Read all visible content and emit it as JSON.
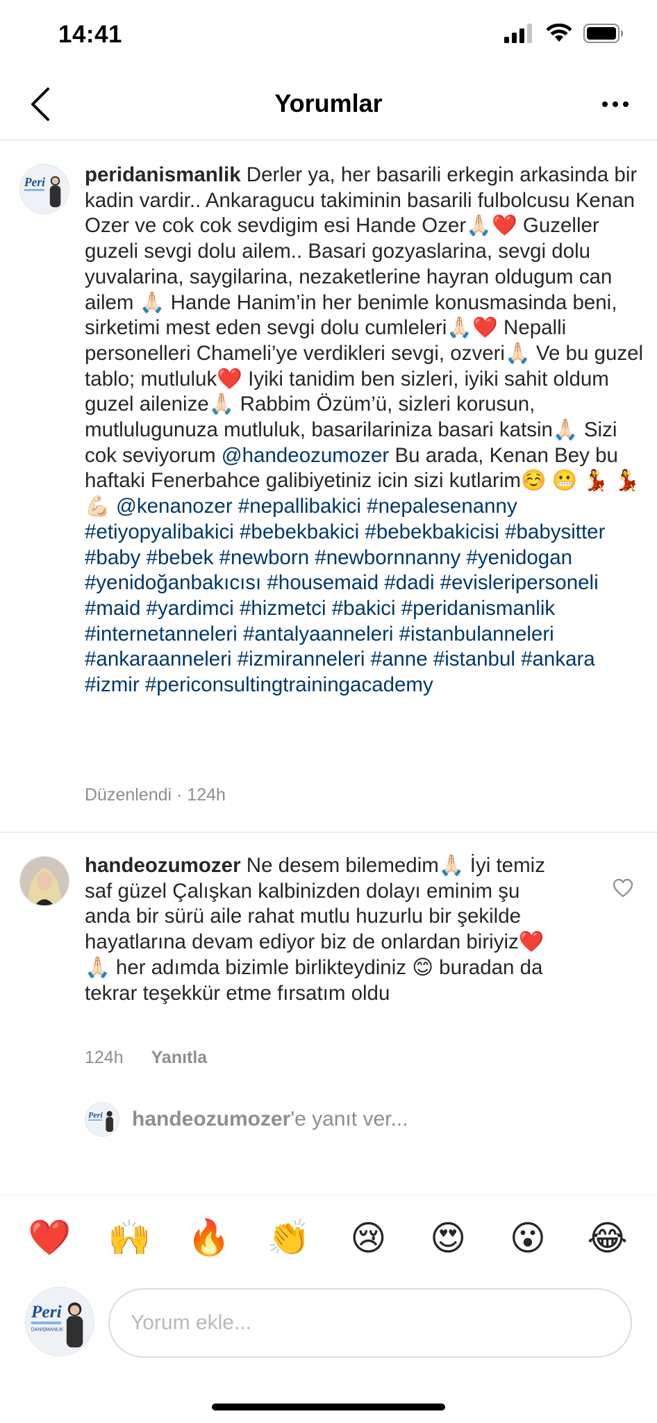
{
  "status_bar": {
    "time": "14:41"
  },
  "nav": {
    "title": "Yorumlar"
  },
  "caption": {
    "username": "peridanismanlik",
    "text_1": " Derler ya, her basarili erkegin arkasinda bir kadin vardir.. Ankaragucu takiminin basarili fulbolcusu Kenan Ozer ve cok cok sevdigim esi Hande Ozer🙏🏻❤️ Guzeller guzeli sevgi dolu ailem.. Basari gozyaslarina, sevgi dolu yuvalarina, saygilarina, nezaketlerine hayran oldugum can ailem 🙏🏻 Hande Hanim’in her benimle konusmasinda beni, sirketimi mest eden sevgi dolu cumleleri🙏🏻❤️ Nepalli personelleri Chameli’ye verdikleri sevgi, ozveri🙏🏻 Ve bu guzel tablo; mutluluk❤️ Iyiki tanidim ben sizleri, iyiki sahit oldum guzel ailenize🙏🏻 Rabbim Özüm’ü, sizleri korusun, mutlulugunuza mutluluk, basarilariniza basari katsin🙏🏻 Sizi cok seviyorum ",
    "mention_1": "@handeozumozer",
    "text_2": " Bu arada, Kenan Bey bu haftaki Fenerbahce galibiyetiniz icin sizi kutlarim☺️ 😬 💃 💃 💪🏻 ",
    "mention_2": "@kenanozer",
    "hashtags": "#nepallibakici #nepalesenanny #etiyopyalibakici #bebekbakici #bebekbakicisi #babysitter #baby #bebek #newborn #newbornnanny #yenidogan #yenidoğanbakıcısı #housemaid #dadi #evisleripersoneli #maid #yardimci #hizmetci #bakici #peridanismanlik #internetanneleri #antalyaanneleri #istanbulanneleri #ankaraanneleri #izmiranneleri #anne #istanbul #ankara #izmir #periconsultingtrainingacademy",
    "meta": "Düzenlendi · 124h"
  },
  "comment": {
    "username": "handeozumozer",
    "text": " Ne desem bilemedim🙏🏻 İyi temiz saf güzel Çalışkan  kalbinizden dolayı eminim şu anda bir sürü aile rahat mutlu huzurlu bir şekilde hayatlarına devam ediyor biz de onlardan biriyiz❤️ 🙏🏻 her adımda bizimle birlikteydiniz 😊 buradan da tekrar teşekkür etme fırsatım oldu",
    "time": "124h",
    "reply_label": "Yanıtla"
  },
  "reply_prompt": {
    "username": "handeozumozer",
    "suffix": "'e yanıt ver..."
  },
  "emoji_bar": [
    "❤️",
    "🙌",
    "🔥",
    "👏",
    "😢",
    "😍",
    "😮",
    "😂"
  ],
  "composer": {
    "placeholder": "Yorum ekle..."
  },
  "avatar_text": {
    "brand": "Peri",
    "sub": "DANIŞMANLIK"
  }
}
